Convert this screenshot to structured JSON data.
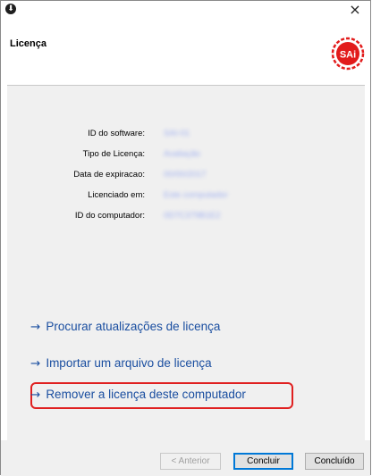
{
  "window": {
    "title": "Licença",
    "close_glyph": "×",
    "app_icon_glyph": "⬇",
    "logo_text": "SAi"
  },
  "license_info": [
    {
      "label": "ID do software:",
      "value": "SAI-01"
    },
    {
      "label": "Tipo de Licença:",
      "value": "Avaliação"
    },
    {
      "label": "Data de expiracao:",
      "value": "00/00/2017"
    },
    {
      "label": "Licenciado em:",
      "value": "Este computador"
    },
    {
      "label": "ID do computador:",
      "value": "0D7C379B1E2"
    }
  ],
  "links": [
    {
      "label": "Procurar atualizações de licença",
      "arrow": "→"
    },
    {
      "label": "Importar um arquivo de licença",
      "arrow": "→"
    },
    {
      "label": "Remover a licença deste computador",
      "arrow": "→"
    }
  ],
  "buttons": {
    "back": "< Anterior",
    "finish": "Concluir",
    "done": "Concluído"
  },
  "colors": {
    "link": "#1a4ea0",
    "highlight": "#e02020",
    "logo_red": "#e21b1b"
  }
}
